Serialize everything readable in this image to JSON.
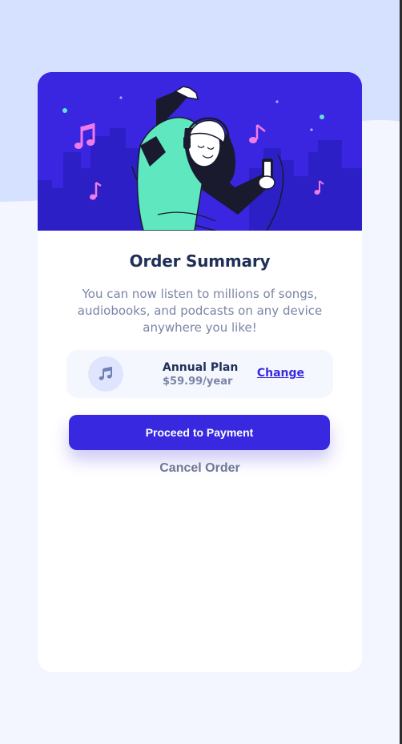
{
  "card": {
    "title": "Order Summary",
    "description": "You can now listen to millions of songs, audiobooks, and podcasts on any device anywhere you like!"
  },
  "plan": {
    "icon": "music-note-icon",
    "name": "Annual Plan",
    "price": "$59.99/year",
    "change_label": "Change"
  },
  "actions": {
    "proceed_label": "Proceed to Payment",
    "cancel_label": "Cancel Order"
  },
  "colors": {
    "page_background": "#f4f6ff",
    "top_wave": "#d6e0ff",
    "hero_background": "#3a26e0",
    "primary": "#3829e0",
    "title": "#1f2f56",
    "text_muted": "#7b84a6",
    "plan_background": "#f5f7ff",
    "icon_circle": "#dfe5ff"
  }
}
